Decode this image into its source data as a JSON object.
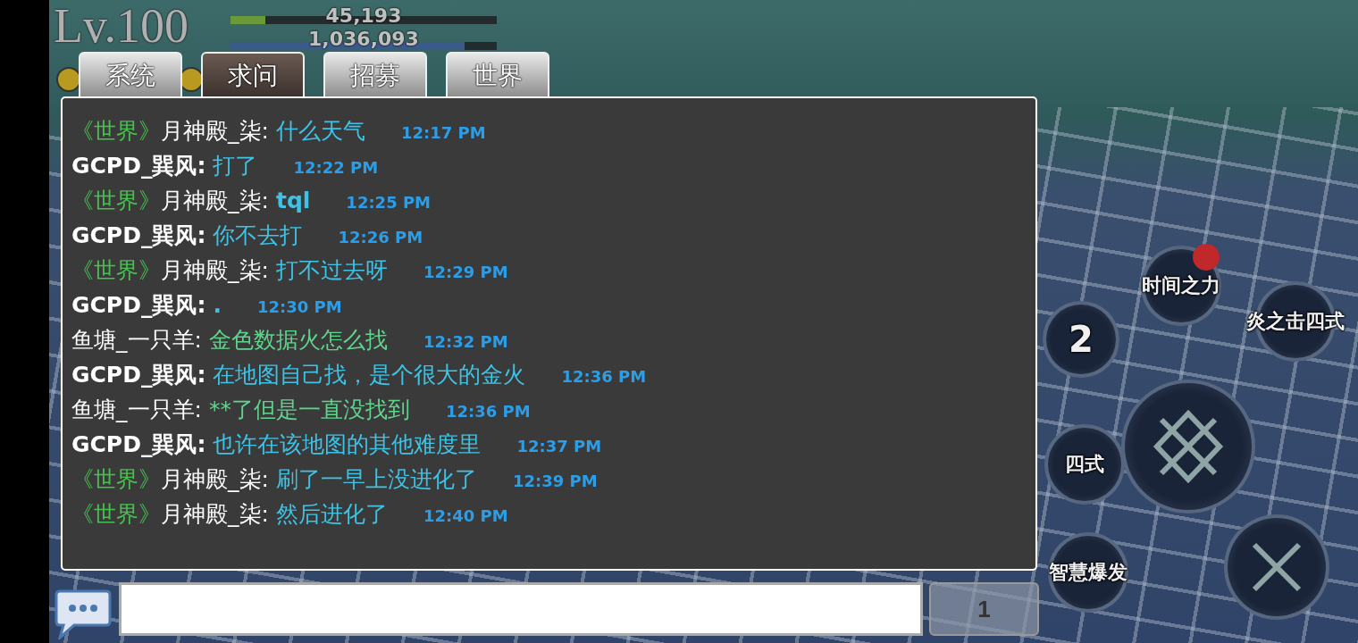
{
  "player": {
    "level": "Lv.100",
    "hp": {
      "reading": "45,193",
      "level": 0.13
    },
    "exp": {
      "reading": "1,036,093",
      "level": 0.88
    }
  },
  "tabs": [
    {
      "label": "系统",
      "selected": false
    },
    {
      "label": "求问",
      "selected": true
    },
    {
      "label": "招募",
      "selected": false
    },
    {
      "label": "世界",
      "selected": false
    }
  ],
  "messages": [
    {
      "channel": "《世界》",
      "sender": "月神殿_柒:",
      "sender_bold": false,
      "text": "什么天气",
      "text_bold": false,
      "color": "#3ec3e6",
      "time": "12:17 PM"
    },
    {
      "sender": "GCPD_巽风:",
      "sender_bold": true,
      "text": "打了",
      "text_bold": false,
      "color": "#3ec3e6",
      "time": "12:22 PM"
    },
    {
      "channel": "《世界》",
      "sender": "月神殿_柒:",
      "sender_bold": false,
      "text": "tql",
      "text_bold": true,
      "color": "#3ec3e6",
      "time": "12:25 PM"
    },
    {
      "sender": "GCPD_巽风:",
      "sender_bold": true,
      "text": "你不去打",
      "text_bold": false,
      "color": "#3ec3e6",
      "time": "12:26 PM"
    },
    {
      "channel": "《世界》",
      "sender": "月神殿_柒:",
      "sender_bold": false,
      "text": "打不过去呀",
      "text_bold": false,
      "color": "#3ec3e6",
      "time": "12:29 PM"
    },
    {
      "sender": "GCPD_巽风:",
      "sender_bold": true,
      "text": ".",
      "text_bold": true,
      "color": "#3ec3e6",
      "time": "12:30 PM"
    },
    {
      "sender": "鱼塘_一只羊:",
      "sender_bold": false,
      "text": "金色数据火怎么找",
      "text_bold": false,
      "color": "#5fd48c",
      "time": "12:32 PM"
    },
    {
      "sender": "GCPD_巽风:",
      "sender_bold": true,
      "text": "在地图自己找，是个很大的金火",
      "text_bold": false,
      "color": "#3ec3e6",
      "time": "12:36 PM"
    },
    {
      "sender": "鱼塘_一只羊:",
      "sender_bold": false,
      "text": "**了但是一直没找到",
      "text_bold": false,
      "color": "#5fd48c",
      "time": "12:36 PM"
    },
    {
      "sender": "GCPD_巽风:",
      "sender_bold": true,
      "text": "也许在该地图的其他难度里",
      "text_bold": false,
      "color": "#3ec3e6",
      "time": "12:37 PM"
    },
    {
      "channel": "《世界》",
      "sender": "月神殿_柒:",
      "sender_bold": false,
      "text": "刷了一早上没进化了",
      "text_bold": false,
      "color": "#3ec3e6",
      "time": "12:39 PM"
    },
    {
      "channel": "《世界》",
      "sender": "月神殿_柒:",
      "sender_bold": false,
      "text": "然后进化了",
      "text_bold": false,
      "color": "#3ec3e6",
      "time": "12:40 PM"
    }
  ],
  "skills": [
    {
      "label": "时间之力",
      "kind": "small",
      "alert": true
    },
    {
      "label": "炎之击四式",
      "kind": "small",
      "alert": false
    },
    {
      "label": "2",
      "kind": "item",
      "alert": false
    },
    {
      "label": "四式",
      "kind": "small",
      "alert": false
    },
    {
      "kind": "main",
      "alert": false
    },
    {
      "label": "智慧爆发",
      "kind": "small",
      "alert": false
    },
    {
      "kind": "secondary",
      "alert": false
    }
  ],
  "send_button": {
    "label": "1"
  }
}
